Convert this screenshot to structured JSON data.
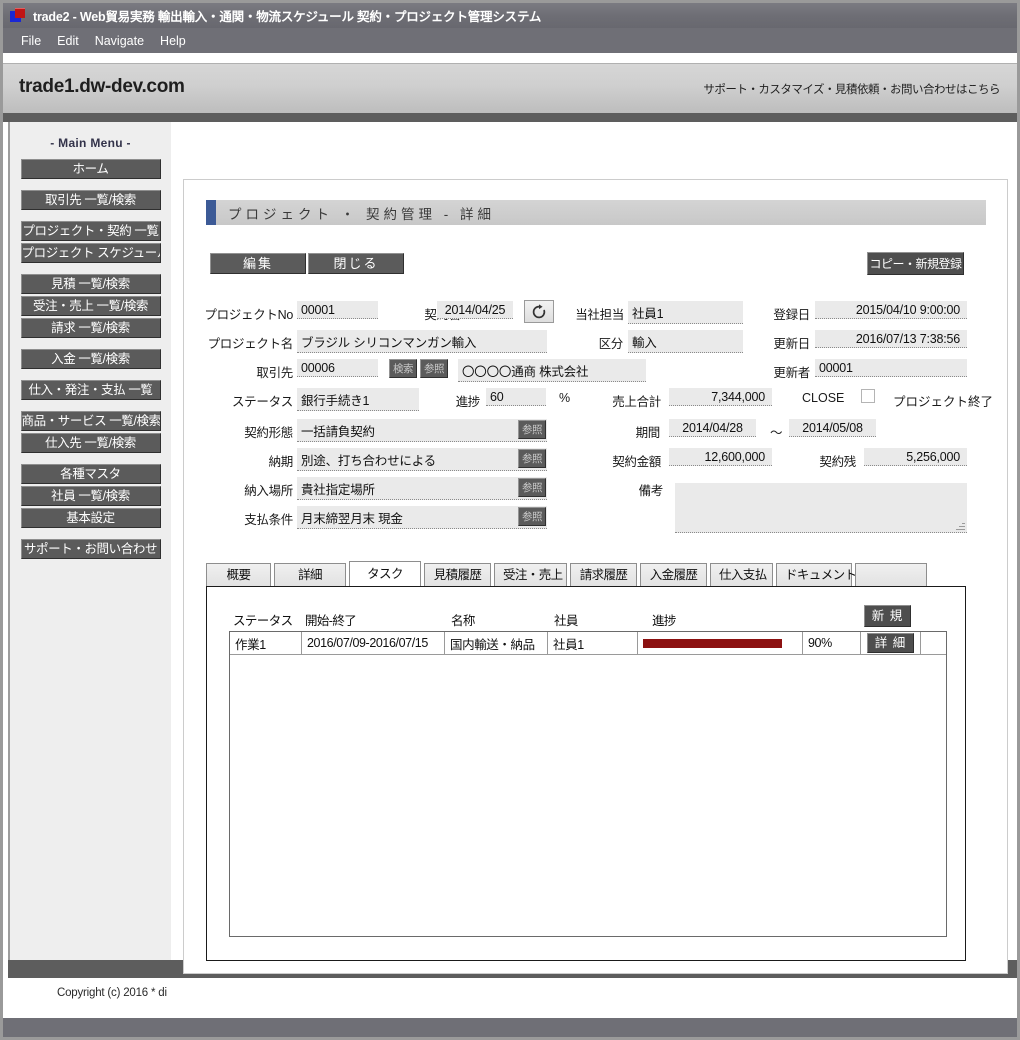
{
  "window": {
    "title": "trade2 - Web貿易実務 輸出輸入・通関・物流スケジュール 契約・プロジェクト管理システム",
    "app_icon": "app-squares-icon",
    "menus": [
      "File",
      "Edit",
      "Navigate",
      "Help"
    ]
  },
  "site_header": {
    "title": "trade1.dw-dev.com",
    "links": "サポート・カスタマイズ・見積依頼・お問い合わせはこちら"
  },
  "sidebar": {
    "heading": "- Main Menu -",
    "groups": [
      {
        "items": [
          "ホーム"
        ]
      },
      {
        "items": [
          "取引先 一覧/検索"
        ]
      },
      {
        "items": [
          "プロジェクト・契約 一覧",
          "プロジェクト スケジュール"
        ]
      },
      {
        "items": [
          "見積 一覧/検索",
          "受注・売上 一覧/検索",
          "請求 一覧/検索"
        ]
      },
      {
        "items": [
          "入金 一覧/検索"
        ]
      },
      {
        "items": [
          "仕入・発注・支払 一覧"
        ]
      },
      {
        "items": [
          "商品・サービス 一覧/検索",
          "仕入先 一覧/検索"
        ]
      },
      {
        "items": [
          "各種マスタ",
          "社員 一覧/検索",
          "基本設定"
        ]
      },
      {
        "items": [
          "サポート・お問い合わせ"
        ]
      }
    ]
  },
  "content": {
    "heading": "プロジェクト ・ 契約管理 - 詳細",
    "buttons": {
      "edit": "編集",
      "close": "閉じる",
      "copy_new": "コピー・新規登録"
    },
    "form": {
      "project_no_label": "プロジェクトNo",
      "project_no_value": "00001",
      "contract_date_label": "契約日",
      "contract_date_value": "2014/04/25",
      "refresh_icon": "refresh-icon",
      "owner_label": "当社担当",
      "owner_value": "社員1",
      "reg_date_label": "登録日",
      "reg_date_value": "2015/04/10 9:00:00",
      "project_name_label": "プロジェクト名",
      "project_name_value": "ブラジル シリコンマンガン輸入",
      "category_label": "区分",
      "category_value": "輸入",
      "upd_date_label": "更新日",
      "upd_date_value": "2016/07/13 7:38:56",
      "customer_label": "取引先",
      "customer_code": "00006",
      "search_btn": "検索",
      "ref_btn": "参照",
      "customer_name": "〇〇〇〇通商 株式会社",
      "updater_label": "更新者",
      "updater_value": "00001",
      "status_label": "ステータス",
      "status_value": "銀行手続き1",
      "progress_label": "進捗",
      "progress_value": "60",
      "percent_sign": "%",
      "sales_total_label": "売上合計",
      "sales_total_value": "7,344,000",
      "close_label": "CLOSE",
      "close_checked": false,
      "close_text": "プロジェクト終了",
      "contract_type_label": "契約形態",
      "contract_type_value": "一括請負契約",
      "period_label": "期間",
      "period_from": "2014/04/28",
      "period_sep": "〜",
      "period_to": "2014/05/08",
      "delivery_label": "納期",
      "delivery_value": "別途、打ち合わせによる",
      "contract_amount_label": "契約金額",
      "contract_amount_value": "12,600,000",
      "contract_balance_label": "契約残",
      "contract_balance_value": "5,256,000",
      "delivery_place_label": "納入場所",
      "delivery_place_value": "貴社指定場所",
      "remarks_label": "備考",
      "remarks_value": "",
      "payment_terms_label": "支払条件",
      "payment_terms_value": "月末締翌月末 現金"
    },
    "tabs": [
      {
        "label": "概要",
        "active": false
      },
      {
        "label": "詳細",
        "active": false
      },
      {
        "label": "タスク",
        "active": true
      },
      {
        "label": "見積履歴",
        "active": false
      },
      {
        "label": "受注・売上",
        "active": false
      },
      {
        "label": "請求履歴",
        "active": false
      },
      {
        "label": "入金履歴",
        "active": false
      },
      {
        "label": "仕入支払",
        "active": false
      },
      {
        "label": "ドキュメント",
        "active": false
      }
    ],
    "task_panel": {
      "columns": [
        "ステータス",
        "開始-終了",
        "名称",
        "社員",
        "進捗"
      ],
      "new_button": "新 規",
      "detail_button": "詳 細",
      "rows": [
        {
          "status": "作業1",
          "dates": "2016/07/09-2016/07/15",
          "name": "国内輸送・納品",
          "employee": "社員1",
          "progress_pct": 90,
          "progress_label": "90%",
          "progress_color": "#8c1111"
        }
      ]
    }
  },
  "footer": {
    "copyright": "Copyright (c) 2016 * di"
  },
  "colors": {
    "accent_blue": "#3c5a96",
    "chrome_gray": "#6f6f76",
    "button_dark": "#5b5b5b",
    "progress_red": "#8c1111"
  }
}
